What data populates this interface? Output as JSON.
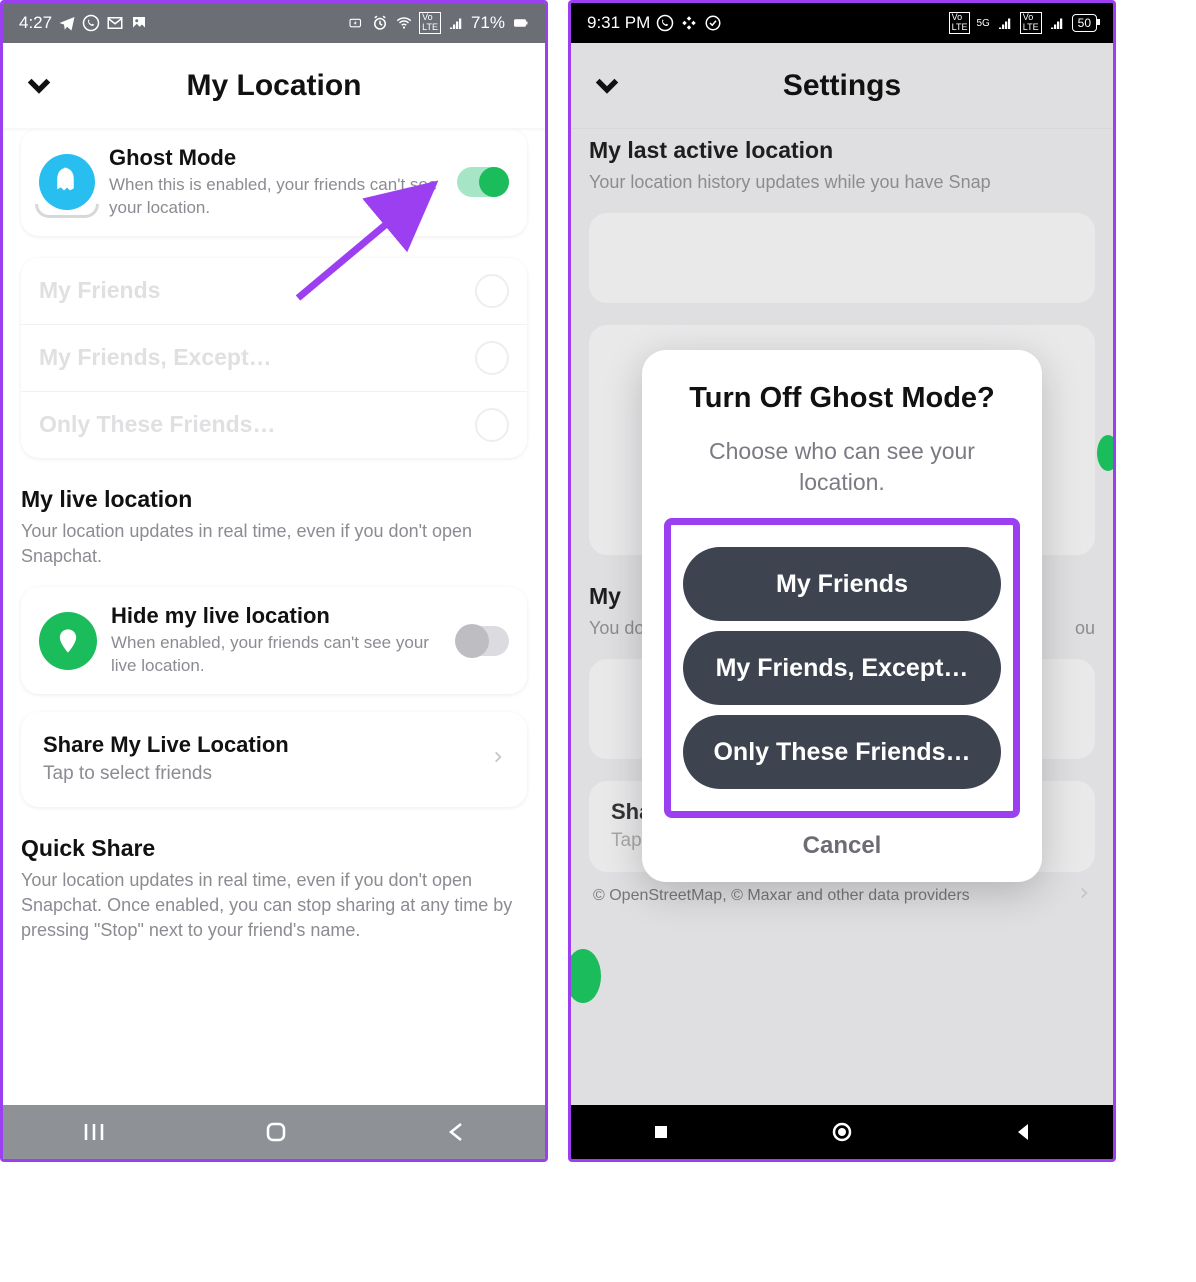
{
  "left": {
    "statusbar": {
      "time": "4:27",
      "battery": "71%"
    },
    "header": {
      "title": "My Location"
    },
    "ghost": {
      "title": "Ghost Mode",
      "sub": "When this is enabled, your friends can't see your location."
    },
    "faded_options": [
      "My Friends",
      "My Friends, Except…",
      "Only These Friends…"
    ],
    "live": {
      "heading": "My live location",
      "sub": "Your location updates in real time, even if you don't open Snapchat."
    },
    "hide": {
      "title": "Hide my live location",
      "sub": "When enabled, your friends can't see your live location."
    },
    "share": {
      "title": "Share My Live Location",
      "sub": "Tap to select friends"
    },
    "quick": {
      "heading": "Quick Share",
      "sub": "Your location updates in real time, even if you don't open Snapchat. Once enabled, you can stop sharing at any time by pressing \"Stop\" next to your friend's name."
    }
  },
  "right": {
    "statusbar": {
      "time": "9:31 PM",
      "battery": "50"
    },
    "header": {
      "title": "Settings"
    },
    "last_active": {
      "heading": "My last active location",
      "sub_partial": "Your location history updates while you have Snap"
    },
    "live": {
      "heading_partial": "My",
      "sub_partial": "You don"
    },
    "share": {
      "title": "Share My Live",
      "sub": "Tap to select friends"
    },
    "map_attr": "© OpenStreetMap, © Maxar and other data providers",
    "modal": {
      "title": "Turn Off Ghost Mode?",
      "sub": "Choose who can see your location.",
      "options": [
        "My Friends",
        "My Friends, Except…",
        "Only These Friends…"
      ],
      "cancel": "Cancel"
    }
  }
}
